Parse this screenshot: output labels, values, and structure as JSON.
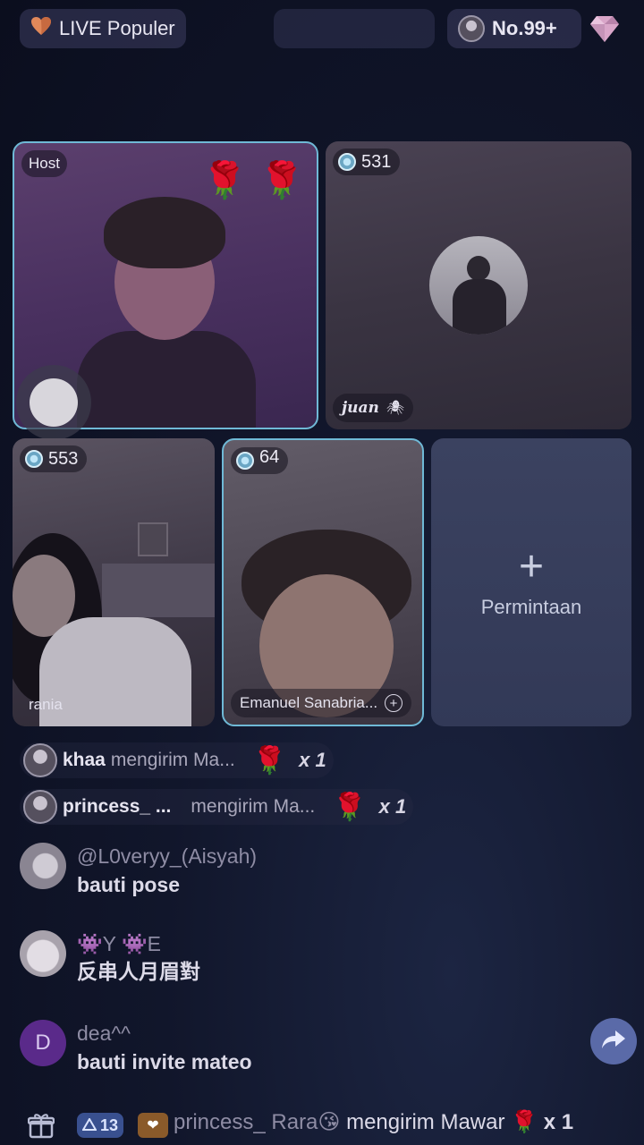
{
  "header": {
    "live_label": "LIVE Populer",
    "rank_label": "No.99+"
  },
  "tiles": {
    "host": {
      "badge": "Host"
    },
    "juan": {
      "viewers": "531",
      "name": "juan"
    },
    "rania": {
      "viewers": "553",
      "name": "rania"
    },
    "emanuel": {
      "viewers": "64",
      "name": "Emanuel Sanabria..."
    },
    "request": {
      "label": "Permintaan"
    }
  },
  "gifts": [
    {
      "user": "khaa",
      "action": "mengirim Ma...",
      "count": "x 1"
    },
    {
      "user": "princess_ ...",
      "action": "mengirim Ma...",
      "count": "x 1"
    }
  ],
  "comments": [
    {
      "user": "@L0veryy_(Aisyah)",
      "text": "bauti pose"
    },
    {
      "user": "👾Y 👾E",
      "text": "反串人月眉對"
    },
    {
      "user": "dea^^",
      "text": "bauti invite mateo",
      "initial": "D"
    }
  ],
  "ticker": {
    "level": "13",
    "user": "princess_ Rara😘",
    "action": "mengirim Mawar",
    "count": "x 1"
  },
  "colors": {
    "background": "#11162b",
    "selected_border": "#6fb9d6",
    "request_tile": "#353c5a",
    "share_button": "#5a6aa8"
  }
}
